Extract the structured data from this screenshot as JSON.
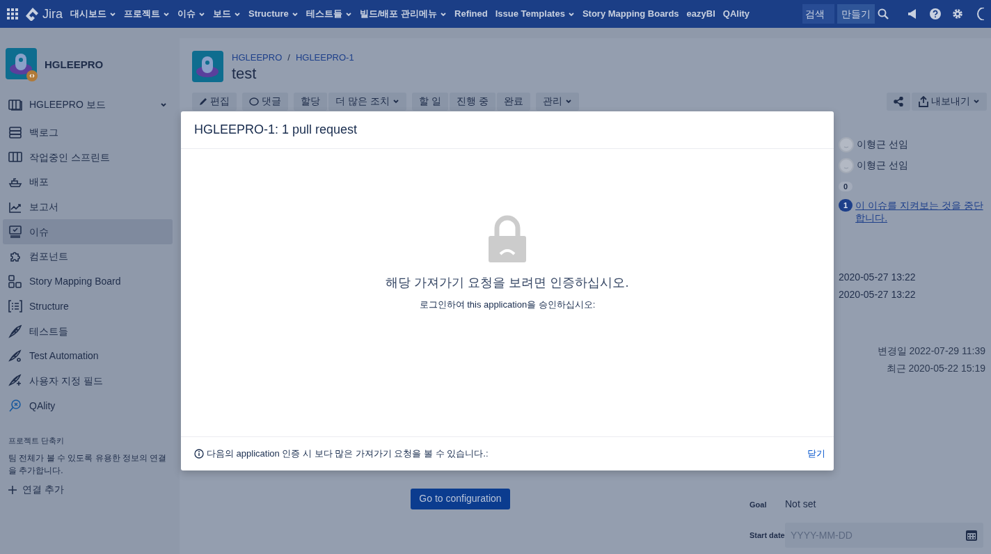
{
  "nav": {
    "brand": "Jira",
    "items": [
      {
        "label": "대시보드",
        "dropdown": true
      },
      {
        "label": "프로젝트",
        "dropdown": true
      },
      {
        "label": "이슈",
        "dropdown": true
      },
      {
        "label": "보드",
        "dropdown": true
      },
      {
        "label": "Structure",
        "dropdown": true
      },
      {
        "label": "테스트들",
        "dropdown": true
      },
      {
        "label": "빌드/배포 관리메뉴",
        "dropdown": true
      },
      {
        "label": "Refined",
        "dropdown": false
      },
      {
        "label": "Issue Templates",
        "dropdown": true
      },
      {
        "label": "Story Mapping Boards",
        "dropdown": false
      },
      {
        "label": "eazyBI",
        "dropdown": false
      },
      {
        "label": "QAlity",
        "dropdown": false
      }
    ],
    "search": {
      "placeholder": "검색"
    },
    "create": "만들기"
  },
  "sidebar": {
    "project": "HGLEEPRO",
    "board": "HGLEEPRO 보드",
    "items": [
      {
        "label": "백로그",
        "selected": false
      },
      {
        "label": "작업중인 스프린트",
        "selected": false
      },
      {
        "label": "배포",
        "selected": false
      },
      {
        "label": "보고서",
        "selected": false
      },
      {
        "label": "이슈",
        "selected": true
      },
      {
        "label": "컴포넌트",
        "selected": false
      },
      {
        "label": "Story Mapping Board",
        "selected": false
      },
      {
        "label": "Structure",
        "selected": false
      },
      {
        "label": "테스트들",
        "selected": false
      },
      {
        "label": "Test Automation",
        "selected": false
      },
      {
        "label": "사용자 지정 필드",
        "selected": false
      },
      {
        "label": "QAlity",
        "selected": false
      }
    ],
    "shortcuts_title": "프로젝트 단축키",
    "shortcuts_text": "팀 전체가 볼 수 있도록 유용한 정보의 연결을 추가합니다.",
    "add_link": "연결 추가"
  },
  "issue": {
    "breadcrumb": [
      "HGLEEPRO",
      "HGLEEPRO-1"
    ],
    "breadcrumb_separator": "/",
    "title": "test",
    "actions": [
      {
        "label": "편집",
        "dropdown": false
      },
      {
        "label": "댓글",
        "dropdown": false
      },
      {
        "label": "할당",
        "dropdown": false
      },
      {
        "label": "더 많은 조치",
        "dropdown": true
      },
      {
        "label": "할 일",
        "dropdown": false
      },
      {
        "label": "진행 중",
        "dropdown": false
      },
      {
        "label": "완료",
        "dropdown": false
      },
      {
        "label": "관리",
        "dropdown": true
      }
    ],
    "export": "내보내기"
  },
  "people": [
    {
      "name": "이형근 선임"
    },
    {
      "name": "이형근 선임"
    }
  ],
  "votes": "0",
  "watchers": "1",
  "watch_link": "이 이슈를 지켜보는 것을 중단합니다.",
  "dates": [
    "2020-05-27 13:22",
    "2020-05-27 13:22"
  ],
  "updated": "변경일 2022-07-29 11:39",
  "recent": "최근 2020-05-22 15:19",
  "config_button": "Go to configuration",
  "sprint_fields": [
    {
      "label": "Goal",
      "kind": "text",
      "value": "Not set"
    },
    {
      "label": "Start date",
      "kind": "date",
      "placeholder": "YYYY-MM-DD"
    }
  ],
  "modal": {
    "title": "HGLEEPRO-1: 1 pull request",
    "message": "해당 가져가기 요청을 보려면 인증하십시오.",
    "sub": "로그인하여 this application을 승인하십시오:",
    "footer": "다음의 application 인증 시 보다 많은 가져가기 요청을 볼 수 있습니다.:",
    "close": "닫기"
  }
}
